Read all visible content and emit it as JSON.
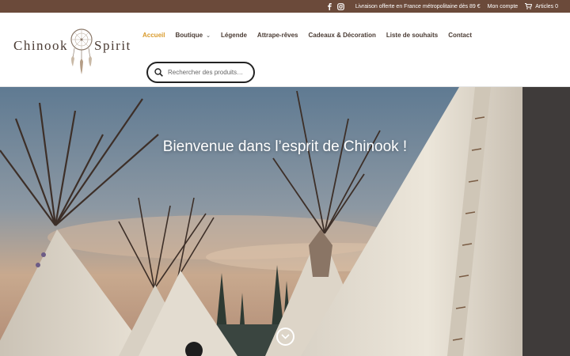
{
  "topbar": {
    "shipping_notice": "Livraison offerte en France métropolitaine dès 89 €",
    "account_label": "Mon compte",
    "cart_label": "Articles 0",
    "bg_color": "#6b4a3a"
  },
  "logo": {
    "word1": "Chinook",
    "word2": "Spirit"
  },
  "nav": {
    "items": [
      {
        "label": "Accueil",
        "active": true
      },
      {
        "label": "Boutique",
        "has_submenu": true
      },
      {
        "label": "Légende"
      },
      {
        "label": "Attrape-rêves"
      },
      {
        "label": "Cadeaux & Décoration"
      },
      {
        "label": "Liste de souhaits"
      },
      {
        "label": "Contact"
      }
    ],
    "active_color": "#d99a2b",
    "submenu_icon": "chevron-down-icon"
  },
  "search": {
    "placeholder": "Rechercher des produits…",
    "icon": "search-icon"
  },
  "hero": {
    "title": "Bienvenue dans l’esprit de Chinook !",
    "scroll_icon": "chevron-down-circle-icon"
  },
  "icons": {
    "facebook": "facebook-icon",
    "instagram": "instagram-icon",
    "cart": "cart-icon"
  }
}
